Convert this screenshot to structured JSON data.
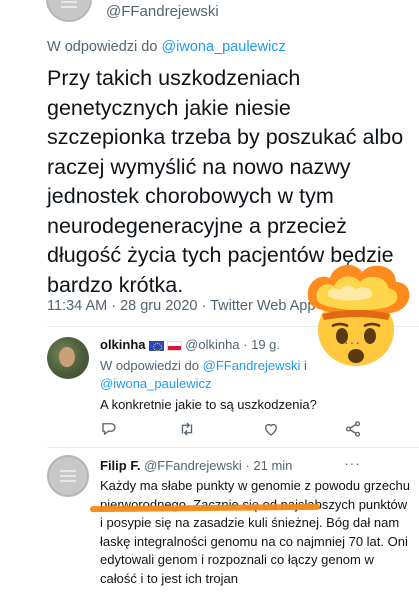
{
  "top": {
    "handle": "@FFandrejewski"
  },
  "main_tweet": {
    "reply_prefix": "W odpowiedzi do ",
    "reply_mention": "@iwona_paulewicz",
    "text": "Przy takich uszkodzeniach genetycznych jakie niesie szczepionka trzeba by poszukać albo raczej wymyślić na nowo nazwy jednostek chorobowych w tym neurodegeneracyjne a przecież długość życia tych pacjentów będzie bardzo krótka.",
    "meta": "11:34 AM · 28 gru 2020 · Twitter Web App"
  },
  "reply1": {
    "name": "olkinha",
    "handle": "@olkinha",
    "time": "· 19 g.",
    "reply_prefix": "W odpowiedzi do ",
    "mention1": "@FFandrejewski",
    "reply_mid": " i",
    "mention2": "@iwona_paulewicz",
    "text": "A konkretnie jakie to są uszkodzenia?",
    "more": "···"
  },
  "reply2": {
    "name": "Filip F.",
    "handle": "@FFandrejewski",
    "time": "· 21 min",
    "more": "···",
    "text": "Każdy ma słabe punkty w genomie z powodu grzechu pierworodnego. Zacznie się od najsłabszych punktów i posypie się na zasadzie kuli śnieżnej. Bóg dał nam łaskę integralności genomu na co najmniej 70 lat. Oni edytowali genom i rozpoznali co łączy genom w całość i to jest ich trojan"
  },
  "icons": [
    "reply-icon",
    "retweet-icon",
    "like-icon",
    "share-icon",
    "more-icon",
    "exploding-head-emoji"
  ],
  "colors": {
    "link": "#1d9bf0",
    "secondary": "#536471",
    "underline": "#f28a1a"
  }
}
